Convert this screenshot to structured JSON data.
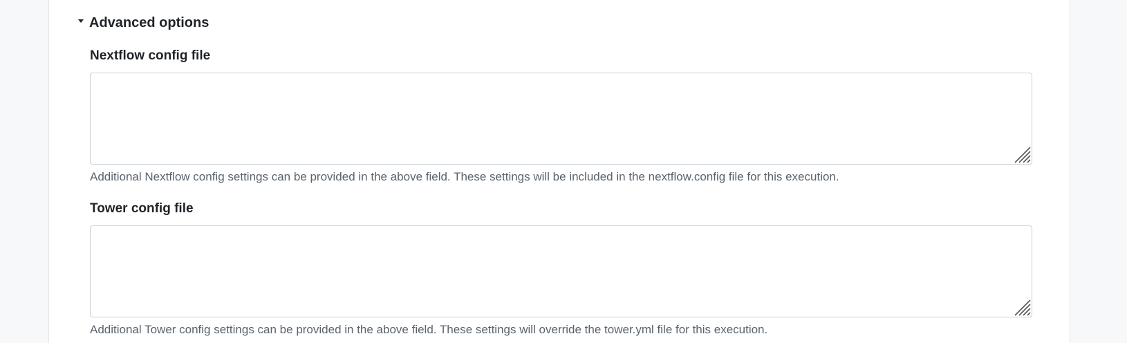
{
  "section": {
    "title": "Advanced options",
    "expanded": true,
    "toggle_icon": "caret-down-icon"
  },
  "fields": [
    {
      "label": "Nextflow config file",
      "value": "",
      "help": "Additional Nextflow config settings can be provided in the above field. These settings will be included in the nextflow.config file for this execution."
    },
    {
      "label": "Tower config file",
      "value": "",
      "help": "Additional Tower config settings can be provided in the above field. These settings will override the tower.yml file for this execution."
    }
  ],
  "colors": {
    "page_background": "#f6f8fa",
    "panel_background": "#ffffff",
    "text_primary": "#1f2328",
    "text_muted": "#59636e",
    "input_border": "#c9ced4"
  }
}
